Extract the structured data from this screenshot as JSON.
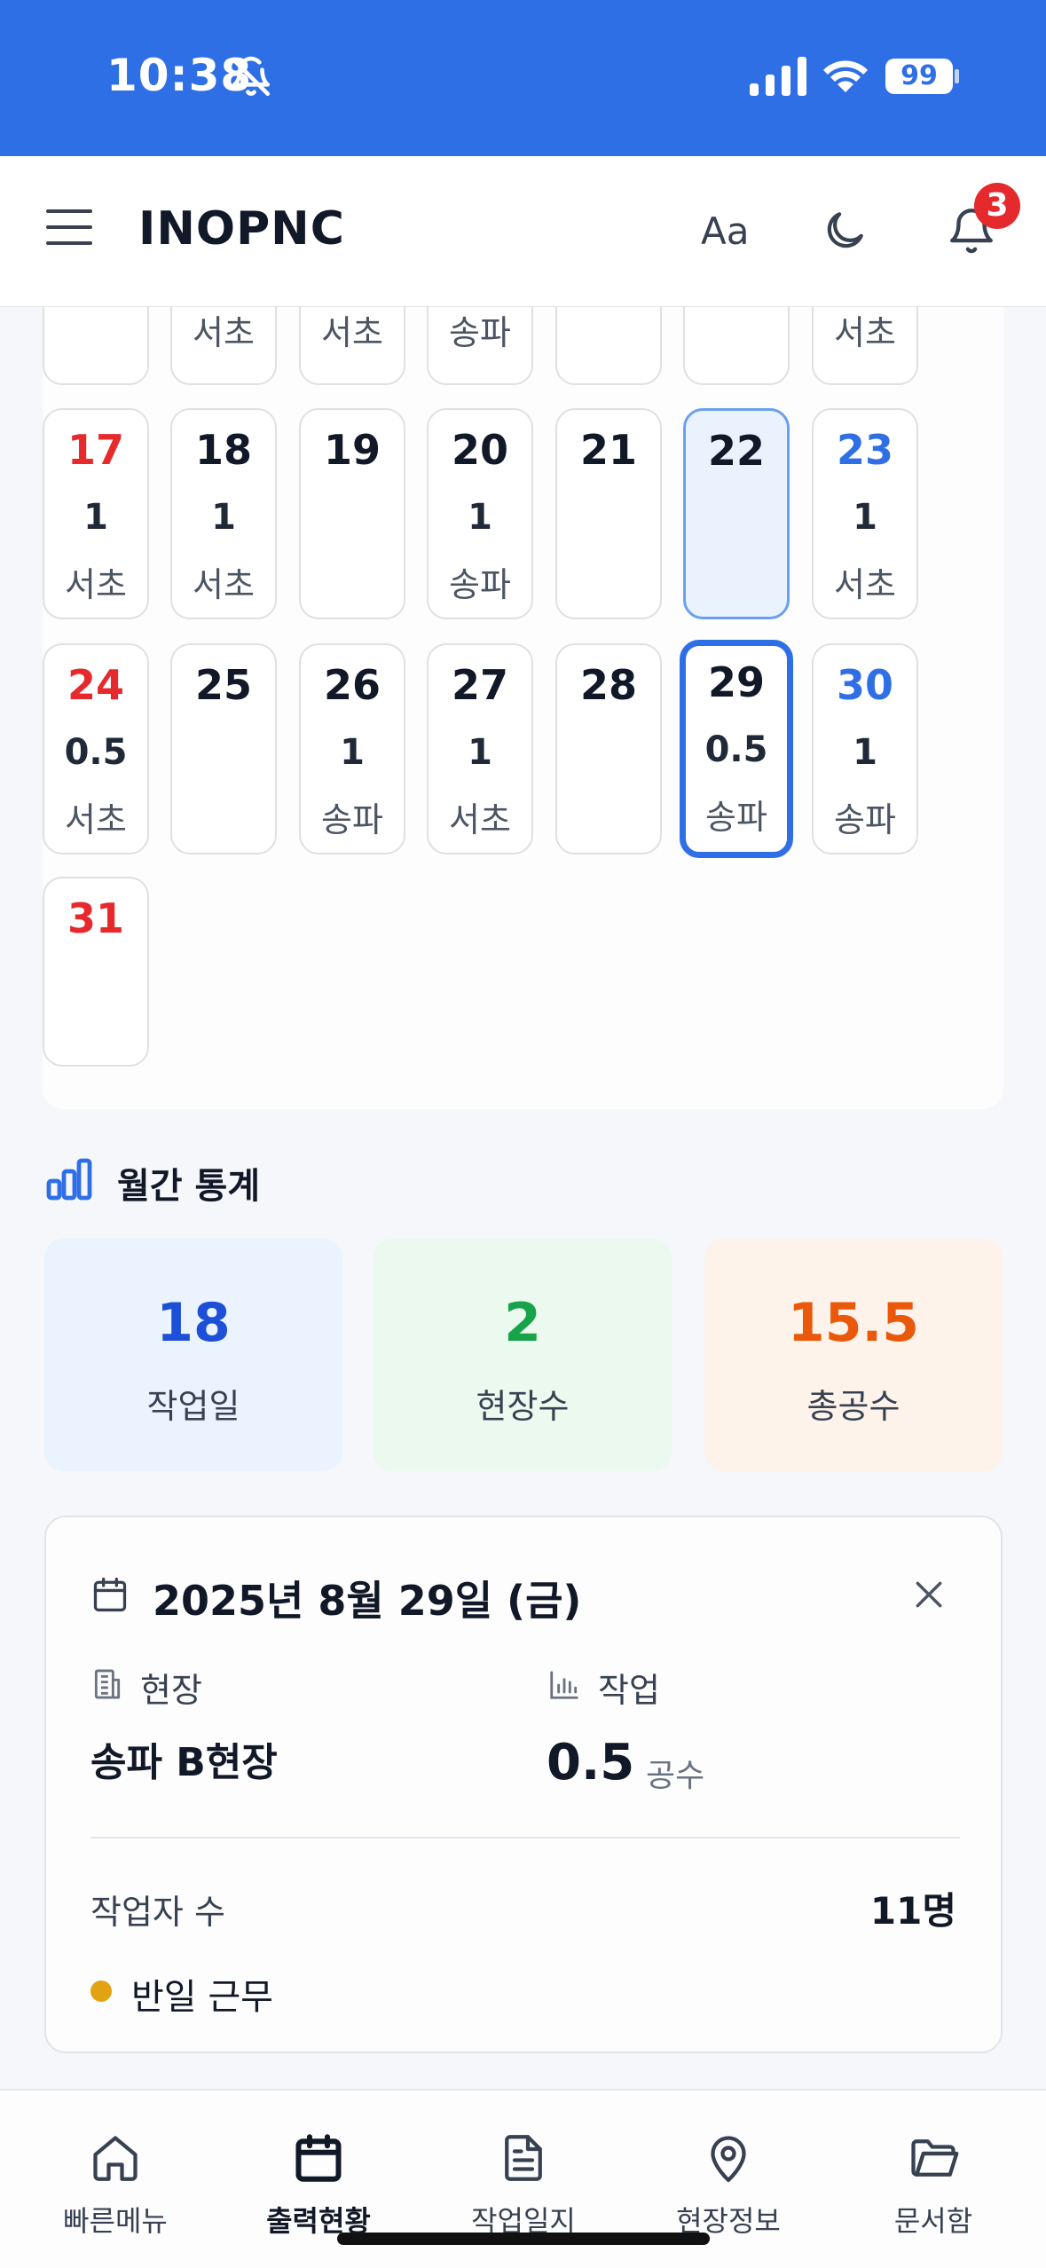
{
  "status_bar": {
    "time": "10:38",
    "battery": "99",
    "icons": [
      "bell-slash-icon",
      "cellular-signal-icon",
      "wifi-icon",
      "battery-icon"
    ]
  },
  "header": {
    "brand": "INOPNC",
    "font_size_label": "Aa",
    "notification_count": "3",
    "icons": [
      "hamburger-menu-icon",
      "moon-icon",
      "bell-icon"
    ]
  },
  "calendar": {
    "partial_row": [
      {
        "day": "",
        "count": "",
        "site": ""
      },
      {
        "day": "",
        "count": "",
        "site": "서초"
      },
      {
        "day": "",
        "count": "",
        "site": "서초"
      },
      {
        "day": "",
        "count": "",
        "site": "송파"
      },
      {
        "day": "",
        "count": "",
        "site": ""
      },
      {
        "day": "",
        "count": "",
        "site": ""
      },
      {
        "day": "",
        "count": "",
        "site": "서초"
      }
    ],
    "weeks": [
      [
        {
          "day": "17",
          "count": "1",
          "site": "서초",
          "weekday": "sun"
        },
        {
          "day": "18",
          "count": "1",
          "site": "서초",
          "weekday": "mon"
        },
        {
          "day": "19",
          "count": "",
          "site": "",
          "weekday": "tue"
        },
        {
          "day": "20",
          "count": "1",
          "site": "송파",
          "weekday": "wed"
        },
        {
          "day": "21",
          "count": "",
          "site": "",
          "weekday": "thu"
        },
        {
          "day": "22",
          "count": "",
          "site": "",
          "weekday": "fri",
          "today": true
        },
        {
          "day": "23",
          "count": "1",
          "site": "서초",
          "weekday": "sat"
        }
      ],
      [
        {
          "day": "24",
          "count": "0.5",
          "site": "서초",
          "weekday": "sun"
        },
        {
          "day": "25",
          "count": "",
          "site": "",
          "weekday": "mon"
        },
        {
          "day": "26",
          "count": "1",
          "site": "송파",
          "weekday": "tue"
        },
        {
          "day": "27",
          "count": "1",
          "site": "서초",
          "weekday": "wed"
        },
        {
          "day": "28",
          "count": "",
          "site": "",
          "weekday": "thu"
        },
        {
          "day": "29",
          "count": "0.5",
          "site": "송파",
          "weekday": "fri",
          "selected": true
        },
        {
          "day": "30",
          "count": "1",
          "site": "송파",
          "weekday": "sat"
        }
      ],
      [
        {
          "day": "31",
          "count": "",
          "site": "",
          "weekday": "sun"
        }
      ]
    ],
    "colors": {
      "sunday": "#e5292d",
      "saturday": "#2f6fe6",
      "selected_border": "#2f6fe6",
      "today_bg": "#eaf2fe"
    }
  },
  "monthly_stats": {
    "title": "월간 통계",
    "icon": "bar-chart-icon",
    "items": [
      {
        "value": "18",
        "label": "작업일",
        "color": "#1d4fd8",
        "bg": "#eaf3fe"
      },
      {
        "value": "2",
        "label": "현장수",
        "color": "#16a34a",
        "bg": "#ecf9ef"
      },
      {
        "value": "15.5",
        "label": "총공수",
        "color": "#ea580c",
        "bg": "#fdf3ea"
      }
    ]
  },
  "detail": {
    "date": "2025년 8월 29일 (금)",
    "site_label": "현장",
    "site_value": "송파 B현장",
    "work_label": "작업",
    "work_value": "0.5",
    "work_unit": "공수",
    "workers_label": "작업자 수",
    "workers_value": "11명",
    "status_text": "반일 근무",
    "status_color": "#e2a313",
    "icons": [
      "calendar-icon",
      "close-icon",
      "building-icon",
      "bar-chart-icon"
    ]
  },
  "bottom_nav": {
    "items": [
      {
        "label": "빠른메뉴",
        "icon": "home-icon"
      },
      {
        "label": "출력현황",
        "icon": "calendar-icon",
        "active": true
      },
      {
        "label": "작업일지",
        "icon": "document-icon"
      },
      {
        "label": "현장정보",
        "icon": "map-pin-icon"
      },
      {
        "label": "문서함",
        "icon": "folder-icon"
      }
    ]
  }
}
